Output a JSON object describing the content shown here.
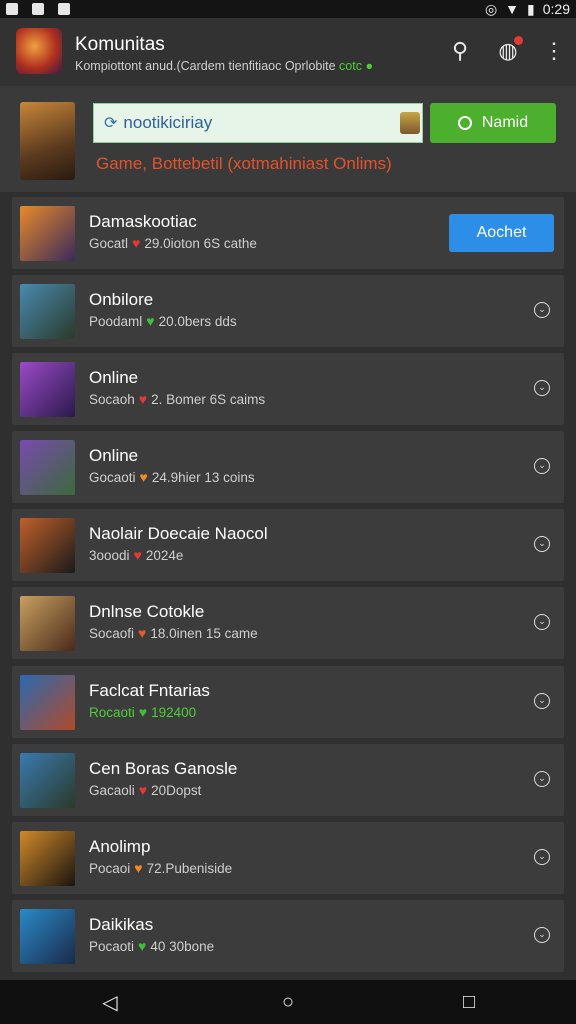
{
  "status_bar": {
    "time": "0:29",
    "icons": [
      "app-icon",
      "app-icon",
      "app-icon"
    ],
    "right_icons": [
      "location-icon",
      "wifi-icon",
      "battery-icon"
    ]
  },
  "app_bar": {
    "title": "Komunitas",
    "subtitle": "Kompiottont anud.(Cardem tienfitiaoc Oprlobite",
    "subtitle_status": "cotc",
    "actions": [
      "search-icon",
      "notification-icon",
      "more-vert-icon"
    ]
  },
  "hero": {
    "search_value": "nootikiciriay",
    "button_label": "Namid",
    "note": "Game, Bottebetil (xotmahiniast Onlims)"
  },
  "games": [
    {
      "title": "Damaskootiac",
      "meta": "Gocatl 29.0ioton 6S cathe",
      "heart_color": "#e53935",
      "meta_green": false,
      "action": "Aochet",
      "thumb": [
        "#e88a2a",
        "#3a2a5a"
      ]
    },
    {
      "title": "Onbilore",
      "meta": "Poodaml 20.0bers dds",
      "heart_color": "#3fbf3a",
      "meta_green": false,
      "action": "",
      "thumb": [
        "#4a8ab0",
        "#2a3a2a"
      ]
    },
    {
      "title": "Online",
      "meta": "Socaoh 2. Bomer 6S caims",
      "heart_color": "#e53935",
      "meta_green": false,
      "action": "",
      "thumb": [
        "#9a4ac8",
        "#2a1a4a"
      ]
    },
    {
      "title": "Online",
      "meta": "Gocaoti 24.9hier 13 coins",
      "heart_color": "#f08a24",
      "meta_green": false,
      "action": "",
      "thumb": [
        "#7a4ab0",
        "#3a6a3a"
      ]
    },
    {
      "title": "Naolair Doecaie Naocol",
      "meta": "3ooodi 2024e",
      "heart_color": "#e53935",
      "meta_green": false,
      "action": "",
      "thumb": [
        "#c0602a",
        "#1a1a1a"
      ]
    },
    {
      "title": "Dnlnse Cotokle",
      "meta": "Socaofi 18.0inen 15 came",
      "heart_color": "#e55a2a",
      "meta_green": false,
      "action": "",
      "thumb": [
        "#c8a060",
        "#4a2a1a"
      ]
    },
    {
      "title": "Faclcat Fntarias",
      "meta": "Rocaoti 192400",
      "heart_color": "#3fbf3a",
      "meta_green": true,
      "action": "",
      "thumb": [
        "#2a6ab0",
        "#b04a2a"
      ]
    },
    {
      "title": "Cen Boras Ganosle",
      "meta": "Gacaoli 20Dopst",
      "heart_color": "#e53935",
      "meta_green": false,
      "action": "",
      "thumb": [
        "#3a7ab0",
        "#2a3a2a"
      ]
    },
    {
      "title": "Anolimp",
      "meta": "Pocaoi 72.Pubeniside",
      "heart_color": "#f08a24",
      "meta_green": false,
      "action": "",
      "thumb": [
        "#d08a2a",
        "#1a1410"
      ]
    },
    {
      "title": "Daikikas",
      "meta": "Pocaoti 40 30bone",
      "heart_color": "#3fbf3a",
      "meta_green": false,
      "action": "",
      "thumb": [
        "#2a8ac8",
        "#1a2a4a"
      ]
    }
  ],
  "nav": [
    "back-icon",
    "home-icon",
    "recents-icon"
  ]
}
